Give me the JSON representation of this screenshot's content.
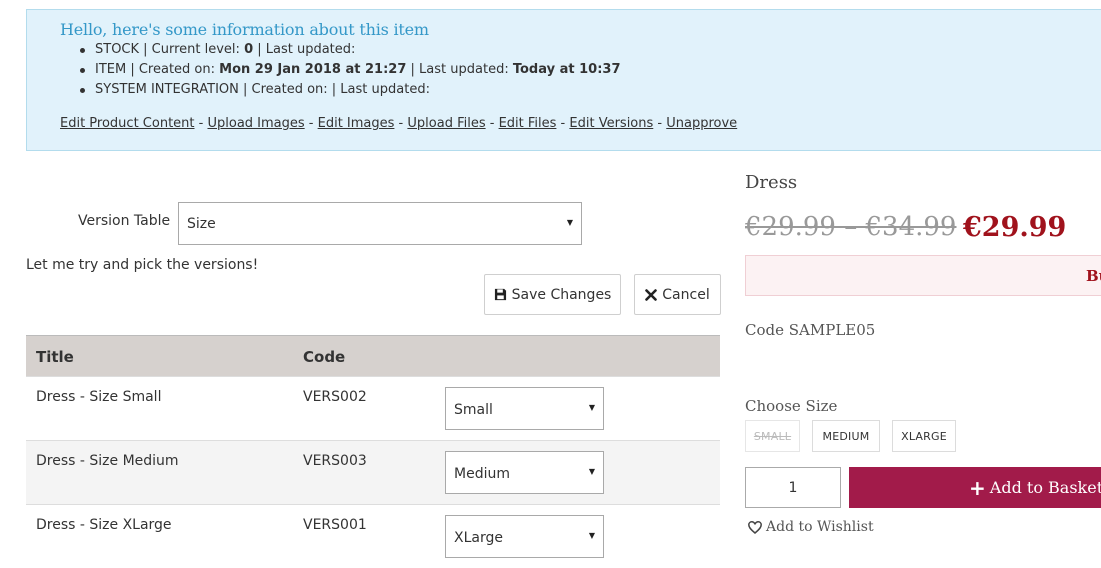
{
  "info": {
    "title": "Hello, here's some information about this item",
    "stock": {
      "prefix": "STOCK | Current level: ",
      "level": "0",
      "suffix": " | Last updated:"
    },
    "item": {
      "prefix": "ITEM | Created on: ",
      "created": "Mon 29 Jan 2018 at 21:27",
      "mid": " | Last updated: ",
      "updated": "Today at 10:37"
    },
    "system": {
      "text": "SYSTEM INTEGRATION | Created on: | Last updated:"
    },
    "links": {
      "edit_content": "Edit Product Content",
      "upload_images": "Upload Images",
      "edit_images": "Edit Images",
      "upload_files": "Upload Files",
      "edit_files": "Edit Files",
      "edit_versions": "Edit Versions",
      "unapprove": "Unapprove",
      "separator": " - "
    }
  },
  "versions": {
    "table_label": "Version Table",
    "table_value": "Size",
    "hint": "Let me try and pick the versions!",
    "save_label": "Save Changes",
    "cancel_label": "Cancel",
    "headers": {
      "title": "Title",
      "code": "Code"
    },
    "rows": [
      {
        "title": "Dress - Size Small",
        "code": "VERS002",
        "version": "Small"
      },
      {
        "title": "Dress - Size Medium",
        "code": "VERS003",
        "version": "Medium"
      },
      {
        "title": "Dress - Size XLarge",
        "code": "VERS001",
        "version": "XLarge"
      }
    ]
  },
  "product": {
    "name": "Dress",
    "old_price": "€29.99 – €34.99",
    "price": "€29.99",
    "buy_bar_text": "Bu",
    "code": "Code SAMPLE05",
    "choose_label": "Choose Size",
    "sizes": [
      "SMALL",
      "MEDIUM",
      "XLARGE"
    ],
    "quantity": "1",
    "add_basket": "Add to Basket",
    "wishlist": "Add to Wishlist"
  },
  "colors": {
    "info_bg": "#e1f2fb",
    "info_title": "#3498c8",
    "price_red": "#a0121c",
    "basket_bg": "#a21b4a",
    "table_header_bg": "#d6d1ce"
  },
  "icons": {
    "save": "floppy-disk-icon",
    "cancel": "x-icon",
    "plus": "plus-icon",
    "wishlist": "heart-icon",
    "dropdown": "caret-down-icon"
  }
}
